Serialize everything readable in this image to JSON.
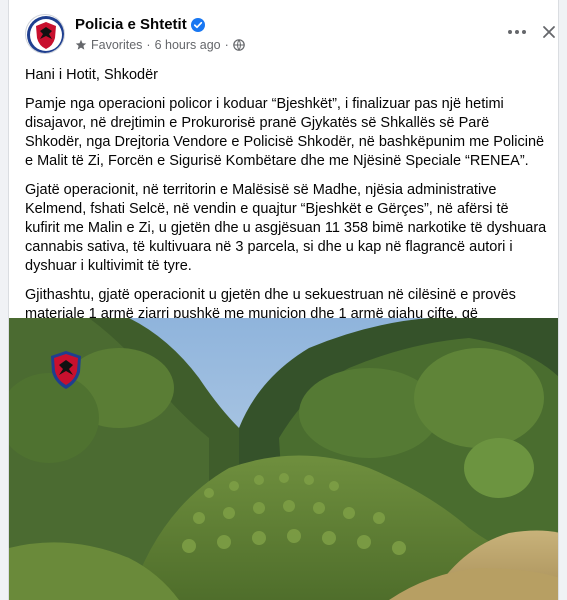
{
  "post": {
    "author": "Policia e Shtetit",
    "audience_label": "Favorites",
    "time": "6 hours ago",
    "separator": "·",
    "paragraphs": [
      "Hani i Hotit, Shkodër",
      "Pamje nga operacioni policor i koduar “Bjeshkët”, i finalizuar pas një hetimi disajavor, në drejtimin e Prokurorisë pranë Gjykatës së Shkallës së Parë Shkodër, nga Drejtoria Vendore e Policisë Shkodër, në bashkëpunim me Policinë e Malit të Zi, Forcën e Sigurisë Kombëtare dhe me Njësinë Speciale “RENEA”.",
      "Gjatë operacionit, në territorin e Malësisë së Madhe, njësia administrative Kelmend, fshati Selcë, në vendin e quajtur “Bjeshkët e Gërçes”, në afërsi të kufirit me Malin e Zi, u gjetën dhe u asgjësuan 11 358 bimë narkotike të dyshuara cannabis sativa, të kultivuara në 3 parcela, si dhe u kap në flagrancë autori i dyshuar i kultivimit të tyre.",
      "Gjithashtu, gjatë operacionit u gjetën dhe u sekuestruan në cilësinë e provës materiale 1 armë zjarri pushkë me municion dhe 1 armë gjahu çifte, që posedoheshin pa leje."
    ]
  },
  "icons": {
    "avatar": "police-emblem-icon",
    "verified": "verified-badge-icon",
    "favorites": "star-icon",
    "audience": "globe-icon",
    "more": "more-options-icon",
    "close": "close-icon",
    "watermark": "police-emblem-icon"
  },
  "colors": {
    "verified_blue": "#1877f2",
    "meta_gray": "#65676b",
    "emblem_red": "#c8102e",
    "emblem_blue": "#1f3f8f"
  }
}
